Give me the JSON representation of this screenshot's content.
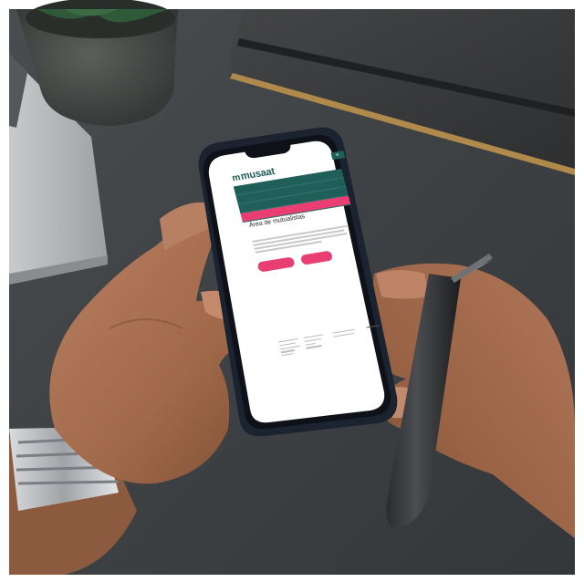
{
  "screen": {
    "logo": "musaat",
    "nav_items": [
      "",
      "",
      "",
      ""
    ],
    "title": "Área de mutualistas",
    "buttons": [
      "",
      ""
    ]
  },
  "colors": {
    "brand_green": "#1f5f59",
    "brand_pink": "#e83e72",
    "table": "#3d4043",
    "notebook": "#3a3a3a",
    "notebook_edge": "#b08a4a",
    "skin": "#a9704f",
    "skin_shadow": "#7b4c33"
  }
}
